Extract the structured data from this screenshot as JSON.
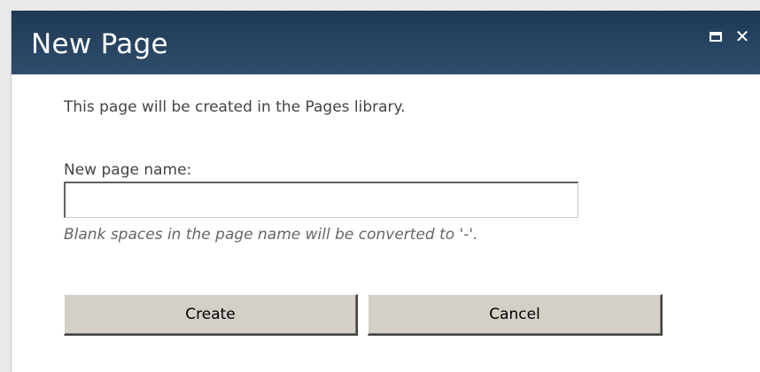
{
  "dialog": {
    "title": "New Page",
    "intro_text": "This page will be created in the Pages library.",
    "name_field": {
      "label": "New page name:",
      "value": "",
      "hint": "Blank spaces in the page name will be converted to '-'."
    },
    "buttons": {
      "create_label": "Create",
      "cancel_label": "Cancel"
    },
    "titlebar_icons": [
      "maximize-icon",
      "close-icon"
    ],
    "colors": {
      "titlebar": "#2a4560",
      "button_face": "#d4d0c8",
      "text": "#444444"
    }
  }
}
